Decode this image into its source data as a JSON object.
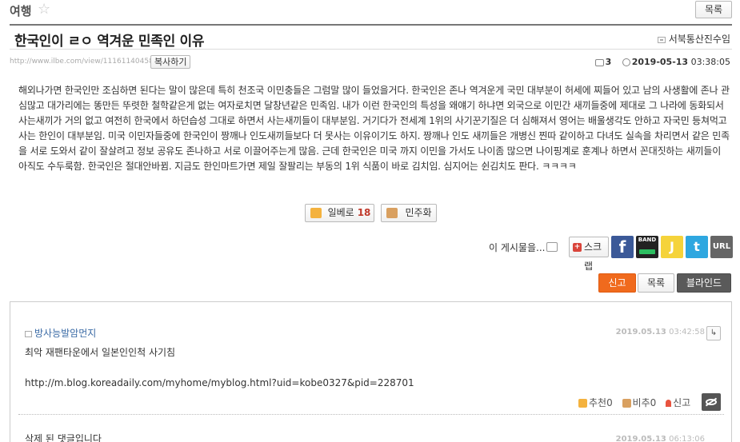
{
  "board": {
    "title": "여행",
    "list_label": "목록"
  },
  "post": {
    "title": "한국인이 ㄹㅇ 역겨운 민족인 이유",
    "author": "서북통산진수임",
    "url": "http://www.ilbe.com/view/11161140458",
    "copy_label": "복사하기",
    "comment_count": "3",
    "date": "2019-05-13",
    "time": "03:38:05",
    "content": "해외나가면 한국인만 조심하면 된다는 말이 많은데 특히 천조국 이민충들은 그럼말 많이 들었을거다. 한국인은 존나 역겨운게 국민 대부분이 허세에 찌들어 있고 남의 사생활에 존나 관심많고 대가리에는 똥만든 뚜렷한 철학같은게 없는 여자로치면 달창년같은 민족임. 내가 이런 한국인의 특성을 왜얘기 하냐면 외국으로 이민간 새끼들중에 제대로 그 나라에 동화되서 사는새끼가 거의 없고 여전히 한국에서 하던습성 그대로 하면서 사는새끼들이 대부분임. 거기다가 전세계 1위의 사기꾼기질은 더 심해져서 영어는 배울생각도 안하고 자국민 등쳐먹고 사는 한인이 대부분임. 미국 이민자들중에 한국인이 짱깨나 인도새끼들보다 더 못사는 이유이기도 하지. 짱깨나 인도 새끼들은 개병신 찐따 같이하고 다녀도 실속을 차리면서 같은 민족을 서로 도와서 같이 잘살려고 정보 공유도 존나하고 서로 이끌어주는게 많음. 근데 한국인은 미국 까지 이민을 가서도 나이좀 많으면 나이핑계로 훈계나 하면서 꼰대짓하는 새끼들이 아직도 수두룩함. 한국인은 절대안바뀜. 지금도 한인마트가면 제일 잘팔리는 부동의 1위 식품이 바로 김치임. 심지어는 쉰김치도 판다. ㅋㅋㅋㅋ"
  },
  "vote": {
    "up_label": "일베로",
    "up_count": "18",
    "down_label": "민주화"
  },
  "share": {
    "prompt": "이 게시물을...",
    "scrap_label": "스크랩",
    "band_label": "BAND",
    "url_label": "URL",
    "fb_glyph": "f",
    "ks_glyph": "J",
    "tw_glyph": "t"
  },
  "actions": {
    "report": "신고",
    "list": "목록",
    "blind": "블라인드"
  },
  "comments": [
    {
      "author": "방사능발암먼지",
      "date": "2019.05.13",
      "time": "03:42:58",
      "text_line1": "최악 재팬타운에서 일본인인척 사기침",
      "text_line2": "http://m.blog.koreadaily.com/myhome/myblog.html?uid=kobe0327&pid=228701",
      "up_label": "추천0",
      "down_label": "비추0",
      "report_label": "신고"
    },
    {
      "text_line1": "삭제 된 댓글입니다",
      "date": "2019.05.13",
      "time": "06:13:06"
    }
  ],
  "icons": {
    "reply_glyph": "↳",
    "star_glyph": "☆"
  },
  "colors": {
    "accent": "#f06a1d",
    "link": "#3a6aa5",
    "vote_red": "#c0392b"
  }
}
